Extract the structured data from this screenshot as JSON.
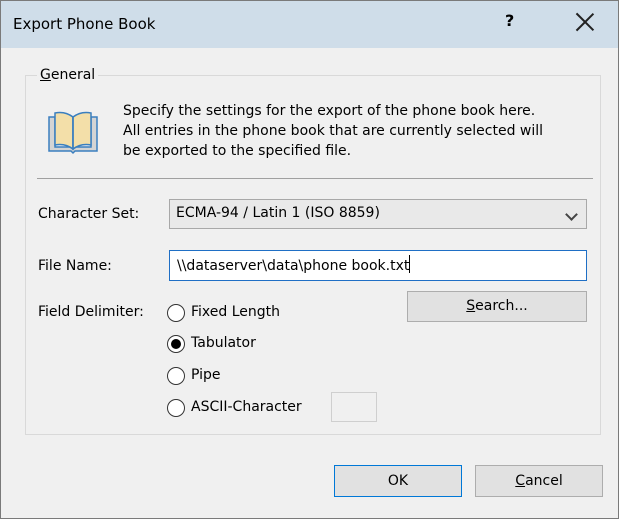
{
  "window": {
    "title": "Export Phone Book",
    "help_label": "?"
  },
  "group": {
    "legend_first": "G",
    "legend_rest": "eneral",
    "description_lines": [
      "Specify the settings for the export of the phone book here.",
      "All entries in the phone book that are currently selected will",
      "be exported to the specified file."
    ],
    "icon": "open-book-icon"
  },
  "charset": {
    "label": "Character Set:",
    "value": "ECMA-94 / Latin 1 (ISO 8859)"
  },
  "filename": {
    "label": "File Name:",
    "value": "\\\\dataserver\\data\\phone book.txt"
  },
  "search_button": {
    "first": "S",
    "rest": "earch..."
  },
  "delimiter": {
    "label": "Field Delimiter:",
    "options": [
      {
        "label": "Fixed Length",
        "selected": false
      },
      {
        "label": "Tabulator",
        "selected": true
      },
      {
        "label": "Pipe",
        "selected": false
      },
      {
        "label": "ASCII-Character",
        "selected": false
      }
    ],
    "ascii_value": ""
  },
  "buttons": {
    "ok": "OK",
    "cancel_first": "C",
    "cancel_rest": "ancel"
  },
  "colors": {
    "titlebar": "#cfdde9",
    "focus_border": "#1f6fc5",
    "default_button_border": "#0078d7"
  }
}
